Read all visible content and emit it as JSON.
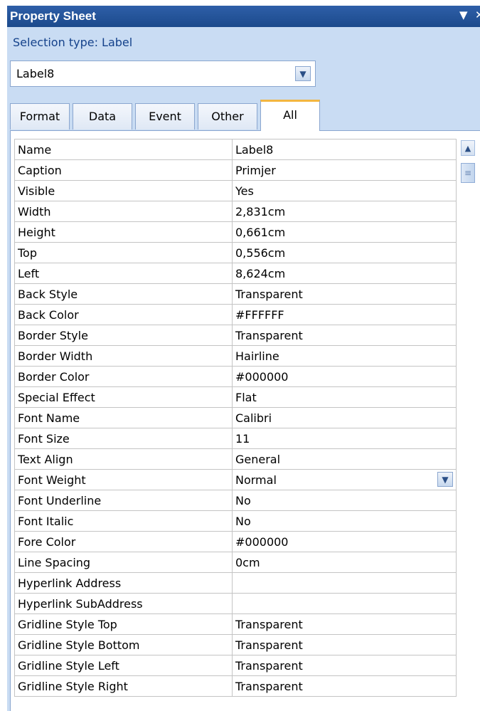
{
  "window": {
    "title": "Property Sheet",
    "menu_icon": "▼",
    "close_icon": "✕"
  },
  "selection_type": "Selection type:  Label",
  "object_selector": {
    "value": "Label8"
  },
  "tabs": [
    {
      "label": "Format"
    },
    {
      "label": "Data"
    },
    {
      "label": "Event"
    },
    {
      "label": "Other"
    },
    {
      "label": "All",
      "active": true
    }
  ],
  "properties": [
    {
      "name": "Name",
      "value": "Label8"
    },
    {
      "name": "Caption",
      "value": "Primjer"
    },
    {
      "name": "Visible",
      "value": "Yes"
    },
    {
      "name": "Width",
      "value": "2,831cm"
    },
    {
      "name": "Height",
      "value": "0,661cm"
    },
    {
      "name": "Top",
      "value": "0,556cm"
    },
    {
      "name": "Left",
      "value": "8,624cm"
    },
    {
      "name": "Back Style",
      "value": "Transparent"
    },
    {
      "name": "Back Color",
      "value": "#FFFFFF"
    },
    {
      "name": "Border Style",
      "value": "Transparent"
    },
    {
      "name": "Border Width",
      "value": "Hairline"
    },
    {
      "name": "Border Color",
      "value": "#000000"
    },
    {
      "name": "Special Effect",
      "value": "Flat"
    },
    {
      "name": "Font Name",
      "value": "Calibri"
    },
    {
      "name": "Font Size",
      "value": "11"
    },
    {
      "name": "Text Align",
      "value": "General"
    },
    {
      "name": "Font Weight",
      "value": "Normal"
    },
    {
      "name": "Font Underline",
      "value": "No"
    },
    {
      "name": "Font Italic",
      "value": "No"
    },
    {
      "name": "Fore Color",
      "value": "#000000"
    },
    {
      "name": "Line Spacing",
      "value": "0cm"
    },
    {
      "name": "Hyperlink Address",
      "value": ""
    },
    {
      "name": "Hyperlink SubAddress",
      "value": ""
    },
    {
      "name": "Gridline Style Top",
      "value": "Transparent"
    },
    {
      "name": "Gridline Style Bottom",
      "value": "Transparent"
    },
    {
      "name": "Gridline Style Left",
      "value": "Transparent"
    },
    {
      "name": "Gridline Style Right",
      "value": "Transparent"
    }
  ],
  "colors": {
    "titlebar": "#1c4a8c",
    "panel_bg": "#c9dcf3",
    "active_tab_accent": "#f3b640",
    "label_text": "#15428b"
  }
}
